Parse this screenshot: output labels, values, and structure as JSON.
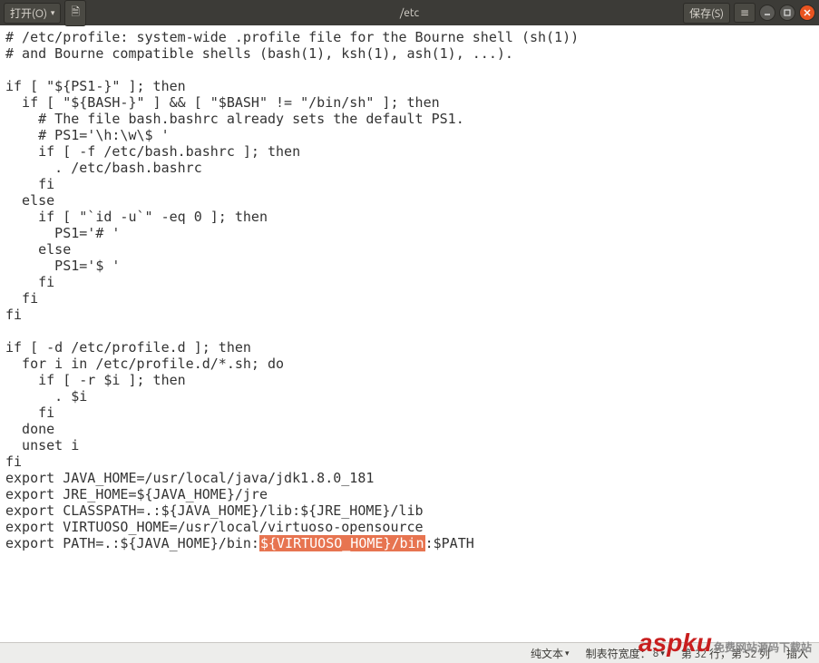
{
  "titlebar": {
    "open_label": "打开(O)",
    "path": "/etc",
    "save_label": "保存(S)"
  },
  "editor": {
    "lines": [
      "# /etc/profile: system-wide .profile file for the Bourne shell (sh(1))",
      "# and Bourne compatible shells (bash(1), ksh(1), ash(1), ...).",
      "",
      "if [ \"${PS1-}\" ]; then",
      "  if [ \"${BASH-}\" ] && [ \"$BASH\" != \"/bin/sh\" ]; then",
      "    # The file bash.bashrc already sets the default PS1.",
      "    # PS1='\\h:\\w\\$ '",
      "    if [ -f /etc/bash.bashrc ]; then",
      "      . /etc/bash.bashrc",
      "    fi",
      "  else",
      "    if [ \"`id -u`\" -eq 0 ]; then",
      "      PS1='# '",
      "    else",
      "      PS1='$ '",
      "    fi",
      "  fi",
      "fi",
      "",
      "if [ -d /etc/profile.d ]; then",
      "  for i in /etc/profile.d/*.sh; do",
      "    if [ -r $i ]; then",
      "      . $i",
      "    fi",
      "  done",
      "  unset i",
      "fi",
      "export JAVA_HOME=/usr/local/java/jdk1.8.0_181",
      "export JRE_HOME=${JAVA_HOME}/jre",
      "export CLASSPATH=.:${JAVA_HOME}/lib:${JRE_HOME}/lib",
      "export VIRTUOSO_HOME=/usr/local/virtuoso-opensource"
    ],
    "lastline_prefix": "export PATH=.:${JAVA_HOME}/bin:",
    "lastline_highlight": "${VIRTUOSO_HOME}/bin",
    "lastline_suffix": ":$PATH"
  },
  "status": {
    "filetype": "纯文本",
    "tabwidth_label": "制表符宽度：",
    "tabwidth_value": "8",
    "position": "第 32 行，第 52 列",
    "mode": "插入"
  },
  "watermark": {
    "red": "aspku",
    "gray": "免费网站源码下载站"
  }
}
